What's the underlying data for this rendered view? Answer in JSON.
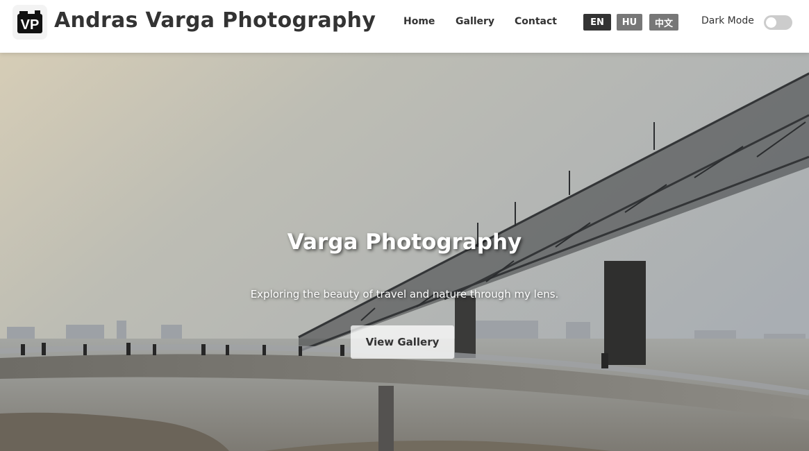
{
  "header": {
    "logo_text": "VP",
    "brand": "Andras Varga Photography",
    "nav": [
      {
        "label": "Home"
      },
      {
        "label": "Gallery"
      },
      {
        "label": "Contact"
      }
    ],
    "languages": [
      {
        "label": "EN",
        "active": true
      },
      {
        "label": "HU",
        "active": false
      },
      {
        "label": "中文",
        "active": false
      }
    ],
    "dark_mode_label": "Dark Mode",
    "dark_mode_on": false
  },
  "hero": {
    "title": "Varga Photography",
    "subtitle": "Exploring the beauty of travel and nature through my lens.",
    "button_label": "View Gallery",
    "background_icon": "bridge-river-photo"
  },
  "colors": {
    "text_dark": "#333333",
    "lang_active": "#333333",
    "lang_inactive": "#777777",
    "toggle_off": "#cccccc"
  }
}
